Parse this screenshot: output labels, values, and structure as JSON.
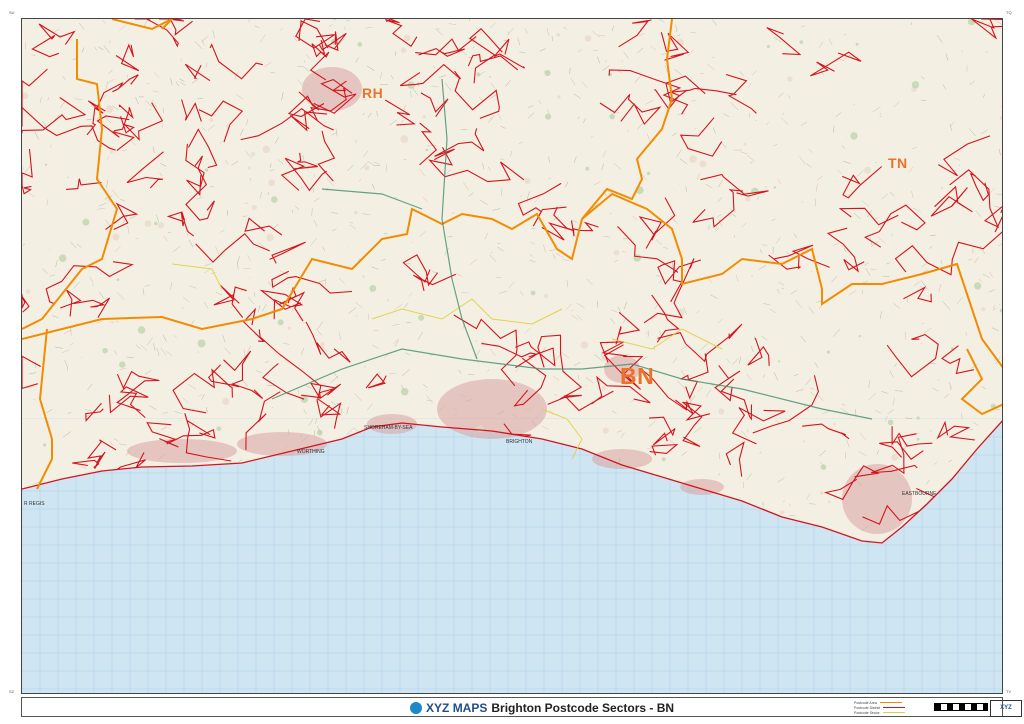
{
  "map": {
    "areas": [
      {
        "code": "RH",
        "color": "#e8742a"
      },
      {
        "code": "TN",
        "color": "#e8742a"
      },
      {
        "code": "BN",
        "color": "#e8742a"
      }
    ],
    "places": {
      "brighton": "BRIGHTON",
      "eastbourne": "EASTBOURNE",
      "shoreham": "SHOREHAM-BY-SEA",
      "worthing": "WORTHING",
      "bognor": "R REGIS"
    },
    "colors": {
      "sea": "#cfe6f2",
      "land": "#f4efe3",
      "area_boundary": "#f28c00",
      "district_boundary": "#d4141c",
      "sector_boundary": "#e0d040",
      "grid": "#9ec9e6",
      "urban": "#d9a3a3"
    },
    "corner_marks": {
      "tl": "SU",
      "tr": "TQ",
      "bl": "SZ",
      "br": "TV"
    }
  },
  "footer": {
    "brand": "XYZ",
    "brand_suffix": "MAPS",
    "title": "Brighton Postcode Sectors - BN",
    "legend": [
      {
        "label": "Postcode Area",
        "color": "#f28c00"
      },
      {
        "label": "Postcode District",
        "color": "#d4141c"
      },
      {
        "label": "Postcode Sector",
        "color": "#e0d040"
      }
    ],
    "badge": "XYZ"
  }
}
